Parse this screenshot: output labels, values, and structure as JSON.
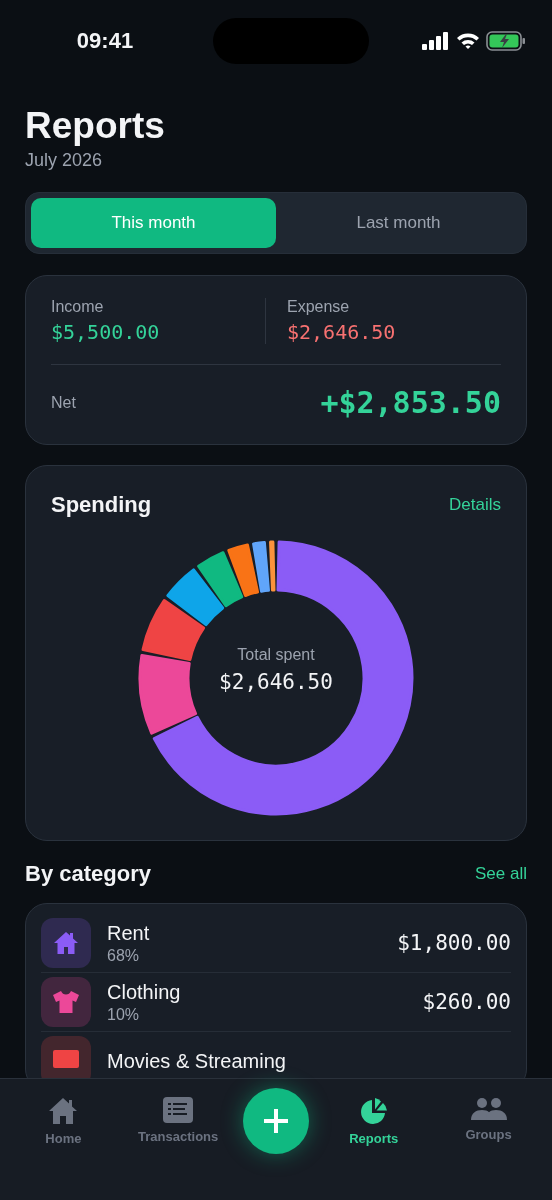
{
  "status_bar": {
    "time": "09:41"
  },
  "header": {
    "title": "Reports",
    "subtitle": "July 2026"
  },
  "period_tabs": [
    {
      "label": "This month",
      "selected": true
    },
    {
      "label": "Last month",
      "selected": false
    }
  ],
  "summary": {
    "income": {
      "label": "Income",
      "value": "$5,500.00"
    },
    "expense": {
      "label": "Expense",
      "value": "$2,646.50"
    },
    "net": {
      "label": "Net",
      "value": "+$2,853.50"
    }
  },
  "spending": {
    "title": "Spending",
    "link": "Details",
    "center_label": "Total spent",
    "center_value": "$2,646.50"
  },
  "by_category": {
    "title": "By category",
    "link": "See all",
    "items": [
      {
        "kind": "rent",
        "name": "Rent",
        "share": "68%",
        "amount": "$1,800.00",
        "color": "#8b5cf6"
      },
      {
        "kind": "clothing",
        "name": "Clothing",
        "share": "10%",
        "amount": "$260.00",
        "color": "#ec4899"
      },
      {
        "kind": "movies",
        "name": "Movies & Streaming",
        "color": "#ef4444"
      }
    ]
  },
  "nav_tabs": [
    {
      "kind": "home",
      "label": "Home",
      "selected": false
    },
    {
      "kind": "transactions",
      "label": "Transactions",
      "selected": false
    },
    {
      "kind": "reports",
      "label": "Reports",
      "selected": true
    },
    {
      "kind": "groups",
      "label": "Groups",
      "selected": false
    }
  ]
}
